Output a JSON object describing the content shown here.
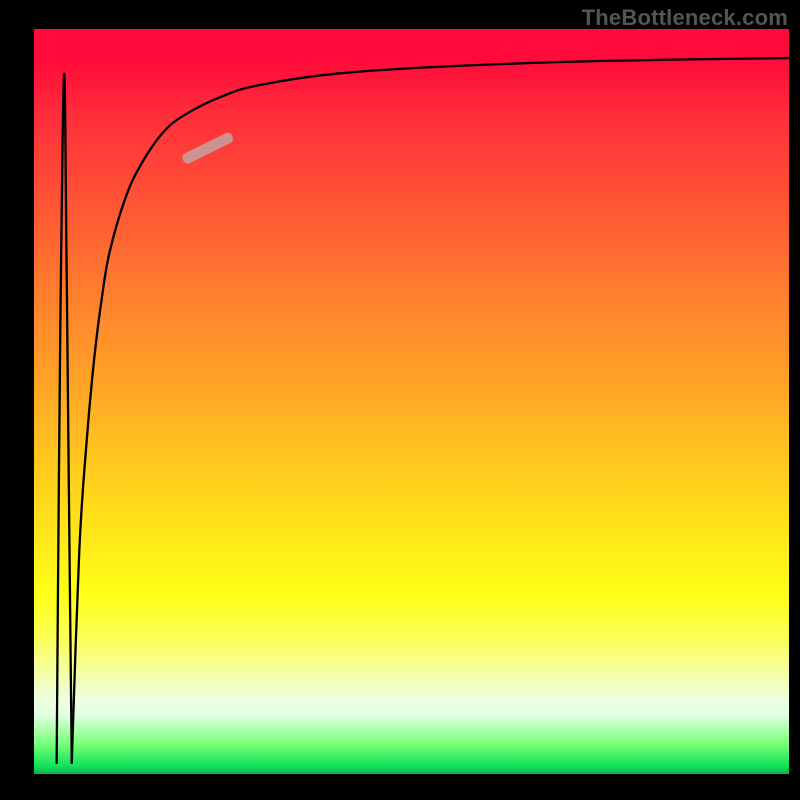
{
  "watermark": "TheBottleneck.com",
  "chart_data": {
    "type": "line",
    "title": "",
    "xlabel": "",
    "ylabel": "",
    "xlim": [
      0,
      100
    ],
    "ylim": [
      0,
      100
    ],
    "grid": false,
    "legend": false,
    "annotations": [],
    "series": [
      {
        "name": "black-curve-left-spike",
        "x": [
          3.0,
          3.3,
          3.6,
          4.0,
          4.3,
          4.6,
          5.0
        ],
        "values": [
          98.5,
          60,
          30,
          6,
          30,
          60,
          98.5
        ]
      },
      {
        "name": "black-curve-main",
        "x": [
          5.0,
          6,
          7,
          8,
          9,
          10,
          12,
          14,
          17,
          20,
          25,
          30,
          40,
          55,
          75,
          100
        ],
        "values": [
          98.5,
          70,
          55,
          44,
          36,
          30,
          23,
          18.5,
          14,
          11.5,
          9.0,
          7.5,
          6.0,
          5.0,
          4.3,
          3.9
        ]
      }
    ],
    "colors": {
      "curve": "#000000",
      "marker": "#c99795"
    },
    "marker": {
      "note": "oblong highlight along the black curve",
      "x_center": 23,
      "y_center": 16
    }
  }
}
